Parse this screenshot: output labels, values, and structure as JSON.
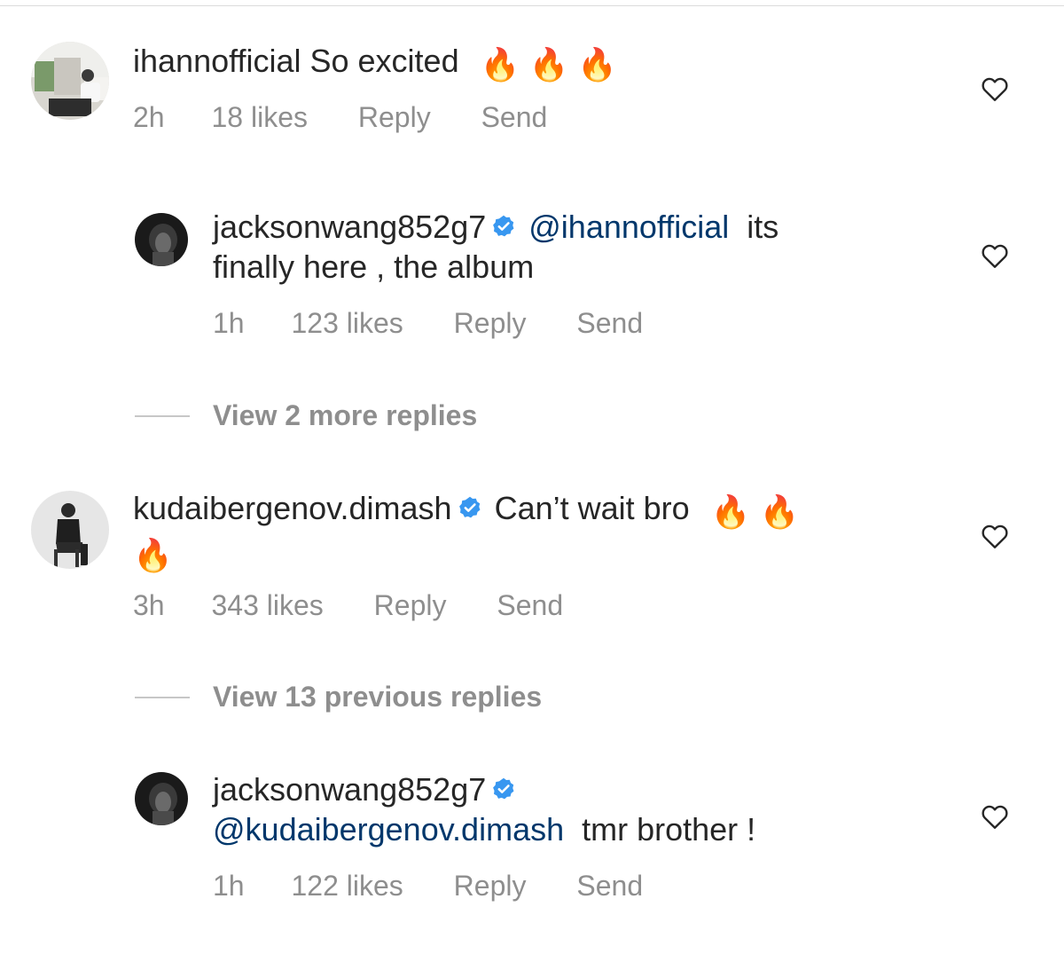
{
  "comments": [
    {
      "username": "ihannofficial",
      "text": "So excited",
      "emoji": [
        "🔥",
        "🔥",
        "🔥"
      ],
      "time": "2h",
      "likes": "18 likes",
      "reply": "Reply",
      "send": "Send"
    },
    {
      "username": "jacksonwang852g7",
      "mention": "@ihannofficial",
      "text_line1": "its",
      "text_line2": "finally here , the album",
      "time": "1h",
      "likes": "123 likes",
      "reply": "Reply",
      "send": "Send"
    },
    {
      "view_more": "View 2 more replies"
    },
    {
      "username": "kudaibergenov.dimash",
      "text": "Can’t wait bro",
      "emoji": [
        "🔥",
        "🔥",
        "🔥"
      ],
      "time": "3h",
      "likes": "343 likes",
      "reply": "Reply",
      "send": "Send"
    },
    {
      "view_more": "View 13 previous replies"
    },
    {
      "username": "jacksonwang852g7",
      "mention": "@kudaibergenov.dimash",
      "text": "tmr brother !",
      "time": "1h",
      "likes": "122 likes",
      "reply": "Reply",
      "send": "Send"
    }
  ],
  "icons": {
    "verified": "verified-badge-icon",
    "heart": "heart-outline-icon",
    "fire": "fire-emoji"
  },
  "colors": {
    "text": "#262626",
    "secondary": "#8e8e8e",
    "mention": "#00376b",
    "verified": "#3897f0"
  }
}
